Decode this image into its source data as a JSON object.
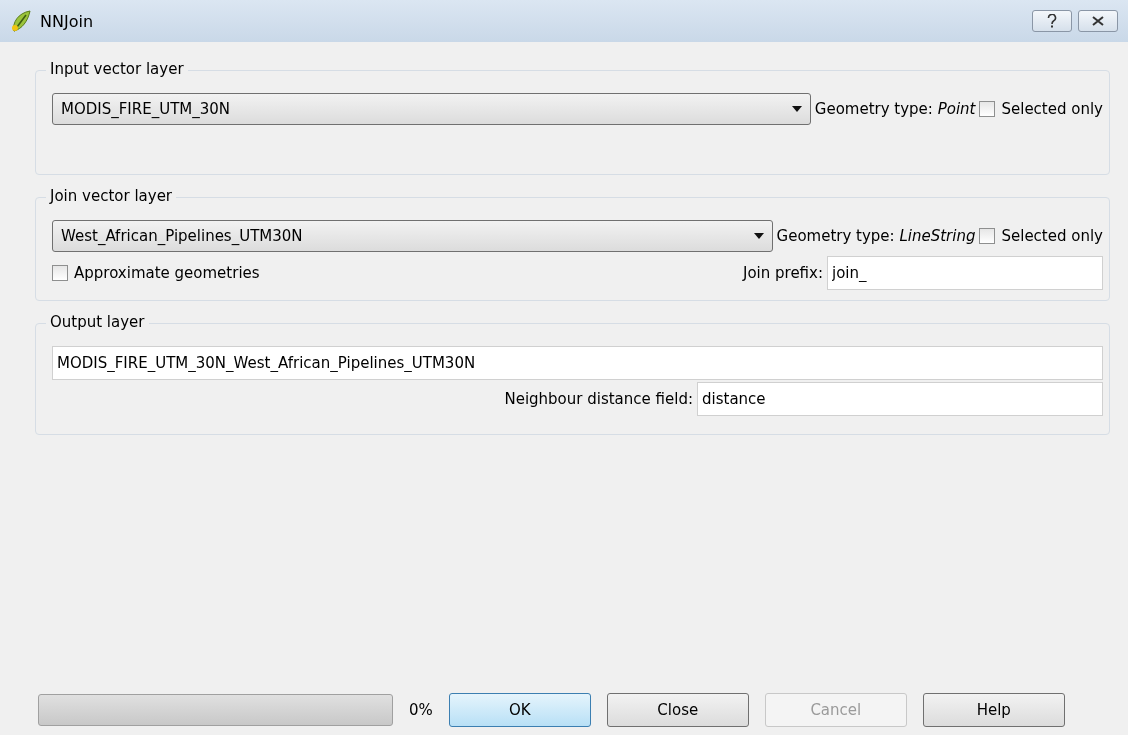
{
  "window": {
    "title": "NNJoin"
  },
  "input_layer": {
    "title": "Input vector layer",
    "layer": "MODIS_FIRE_UTM_30N",
    "geometry_label": "Geometry type:",
    "geometry_type": "Point",
    "selected_only": {
      "label": "Selected only",
      "checked": false
    }
  },
  "join_layer": {
    "title": "Join vector layer",
    "layer": "West_African_Pipelines_UTM30N",
    "geometry_label": "Geometry type:",
    "geometry_type": "LineString",
    "selected_only": {
      "label": "Selected only",
      "checked": false
    },
    "approximate": {
      "label": "Approximate geometries",
      "checked": false
    },
    "prefix_label": "Join prefix:",
    "prefix": "join_"
  },
  "output_layer": {
    "title": "Output layer",
    "name": "MODIS_FIRE_UTM_30N_West_African_Pipelines_UTM30N",
    "distance_label": "Neighbour distance field:",
    "distance": "distance"
  },
  "progress": {
    "level": 0,
    "reading": "0%"
  },
  "buttons": [
    {
      "label": "OK",
      "default": true,
      "disabled": false
    },
    {
      "label": "Close",
      "default": false,
      "disabled": false
    },
    {
      "label": "Cancel",
      "default": false,
      "disabled": true
    },
    {
      "label": "Help",
      "default": false,
      "disabled": false
    }
  ]
}
